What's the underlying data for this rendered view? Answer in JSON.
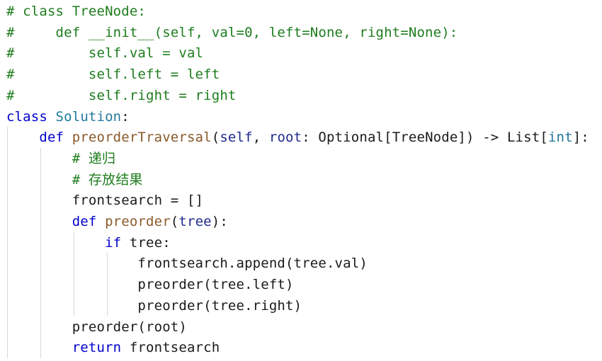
{
  "editor": {
    "language": "python",
    "colors": {
      "background": "#ffffff",
      "comment": "#1e7d1e",
      "keyword": "#0000cc",
      "class_name": "#217a9b",
      "function_name": "#8a5a2b",
      "parameter": "#1f2a8c",
      "builtin": "#1f7399",
      "text": "#1a1a1a",
      "indent_guide": "#d8d8d8"
    },
    "lines": [
      {
        "tokens": [
          {
            "t": "comment",
            "v": "# class TreeNode:"
          }
        ]
      },
      {
        "tokens": [
          {
            "t": "comment",
            "v": "#     def __init__(self, val=0, left=None, right=None):"
          }
        ]
      },
      {
        "tokens": [
          {
            "t": "comment",
            "v": "#         self.val = val"
          }
        ]
      },
      {
        "tokens": [
          {
            "t": "comment",
            "v": "#         self.left = left"
          }
        ]
      },
      {
        "tokens": [
          {
            "t": "comment",
            "v": "#         self.right = right"
          }
        ]
      },
      {
        "tokens": [
          {
            "t": "keyword",
            "v": "class "
          },
          {
            "t": "class",
            "v": "Solution"
          },
          {
            "t": "plain",
            "v": ":"
          }
        ]
      },
      {
        "tokens": [
          {
            "t": "plain",
            "v": "    "
          },
          {
            "t": "keyword",
            "v": "def "
          },
          {
            "t": "func",
            "v": "preorderTraversal"
          },
          {
            "t": "plain",
            "v": "("
          },
          {
            "t": "param",
            "v": "self"
          },
          {
            "t": "plain",
            "v": ", "
          },
          {
            "t": "param",
            "v": "root"
          },
          {
            "t": "plain",
            "v": ": Optional[TreeNode]) -> List["
          },
          {
            "t": "builtin",
            "v": "int"
          },
          {
            "t": "plain",
            "v": "]:"
          }
        ]
      },
      {
        "tokens": [
          {
            "t": "plain",
            "v": "        "
          },
          {
            "t": "comment",
            "v": "# 递归"
          }
        ]
      },
      {
        "tokens": [
          {
            "t": "plain",
            "v": "        "
          },
          {
            "t": "comment",
            "v": "# 存放结果"
          }
        ]
      },
      {
        "tokens": [
          {
            "t": "plain",
            "v": "        frontsearch = []"
          }
        ]
      },
      {
        "tokens": [
          {
            "t": "plain",
            "v": "        "
          },
          {
            "t": "keyword",
            "v": "def "
          },
          {
            "t": "func",
            "v": "preorder"
          },
          {
            "t": "plain",
            "v": "("
          },
          {
            "t": "param",
            "v": "tree"
          },
          {
            "t": "plain",
            "v": "):"
          }
        ]
      },
      {
        "tokens": [
          {
            "t": "plain",
            "v": "            "
          },
          {
            "t": "keyword",
            "v": "if "
          },
          {
            "t": "plain",
            "v": "tree:"
          }
        ]
      },
      {
        "tokens": [
          {
            "t": "plain",
            "v": "                frontsearch.append(tree.val)"
          }
        ]
      },
      {
        "tokens": [
          {
            "t": "plain",
            "v": "                preorder(tree.left)"
          }
        ]
      },
      {
        "tokens": [
          {
            "t": "plain",
            "v": "                preorder(tree.right)"
          }
        ]
      },
      {
        "tokens": [
          {
            "t": "plain",
            "v": "        preorder(root)"
          }
        ]
      },
      {
        "tokens": [
          {
            "t": "plain",
            "v": "        "
          },
          {
            "t": "keyword",
            "v": "return "
          },
          {
            "t": "plain",
            "v": "frontsearch"
          }
        ]
      }
    ]
  }
}
